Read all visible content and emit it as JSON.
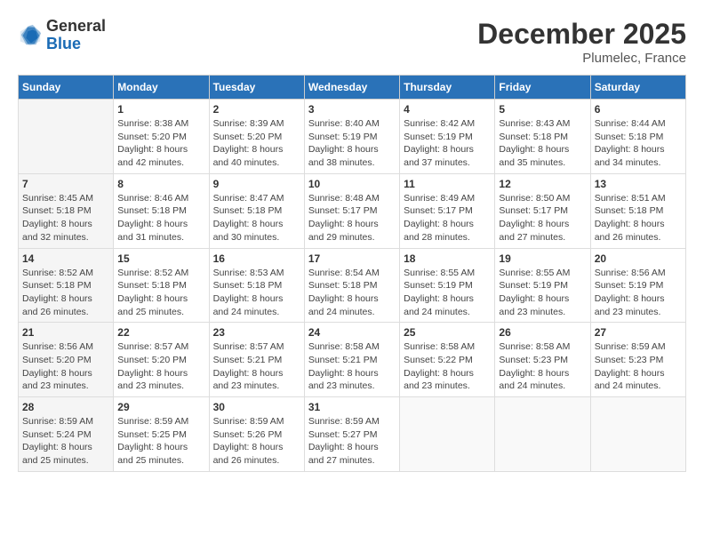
{
  "header": {
    "logo_general": "General",
    "logo_blue": "Blue",
    "month_title": "December 2025",
    "location": "Plumelec, France"
  },
  "days_of_week": [
    "Sunday",
    "Monday",
    "Tuesday",
    "Wednesday",
    "Thursday",
    "Friday",
    "Saturday"
  ],
  "weeks": [
    [
      {
        "day": "",
        "info": ""
      },
      {
        "day": "1",
        "info": "Sunrise: 8:38 AM\nSunset: 5:20 PM\nDaylight: 8 hours\nand 42 minutes."
      },
      {
        "day": "2",
        "info": "Sunrise: 8:39 AM\nSunset: 5:20 PM\nDaylight: 8 hours\nand 40 minutes."
      },
      {
        "day": "3",
        "info": "Sunrise: 8:40 AM\nSunset: 5:19 PM\nDaylight: 8 hours\nand 38 minutes."
      },
      {
        "day": "4",
        "info": "Sunrise: 8:42 AM\nSunset: 5:19 PM\nDaylight: 8 hours\nand 37 minutes."
      },
      {
        "day": "5",
        "info": "Sunrise: 8:43 AM\nSunset: 5:18 PM\nDaylight: 8 hours\nand 35 minutes."
      },
      {
        "day": "6",
        "info": "Sunrise: 8:44 AM\nSunset: 5:18 PM\nDaylight: 8 hours\nand 34 minutes."
      }
    ],
    [
      {
        "day": "7",
        "info": "Sunrise: 8:45 AM\nSunset: 5:18 PM\nDaylight: 8 hours\nand 32 minutes."
      },
      {
        "day": "8",
        "info": "Sunrise: 8:46 AM\nSunset: 5:18 PM\nDaylight: 8 hours\nand 31 minutes."
      },
      {
        "day": "9",
        "info": "Sunrise: 8:47 AM\nSunset: 5:18 PM\nDaylight: 8 hours\nand 30 minutes."
      },
      {
        "day": "10",
        "info": "Sunrise: 8:48 AM\nSunset: 5:17 PM\nDaylight: 8 hours\nand 29 minutes."
      },
      {
        "day": "11",
        "info": "Sunrise: 8:49 AM\nSunset: 5:17 PM\nDaylight: 8 hours\nand 28 minutes."
      },
      {
        "day": "12",
        "info": "Sunrise: 8:50 AM\nSunset: 5:17 PM\nDaylight: 8 hours\nand 27 minutes."
      },
      {
        "day": "13",
        "info": "Sunrise: 8:51 AM\nSunset: 5:18 PM\nDaylight: 8 hours\nand 26 minutes."
      }
    ],
    [
      {
        "day": "14",
        "info": "Sunrise: 8:52 AM\nSunset: 5:18 PM\nDaylight: 8 hours\nand 26 minutes."
      },
      {
        "day": "15",
        "info": "Sunrise: 8:52 AM\nSunset: 5:18 PM\nDaylight: 8 hours\nand 25 minutes."
      },
      {
        "day": "16",
        "info": "Sunrise: 8:53 AM\nSunset: 5:18 PM\nDaylight: 8 hours\nand 24 minutes."
      },
      {
        "day": "17",
        "info": "Sunrise: 8:54 AM\nSunset: 5:18 PM\nDaylight: 8 hours\nand 24 minutes."
      },
      {
        "day": "18",
        "info": "Sunrise: 8:55 AM\nSunset: 5:19 PM\nDaylight: 8 hours\nand 24 minutes."
      },
      {
        "day": "19",
        "info": "Sunrise: 8:55 AM\nSunset: 5:19 PM\nDaylight: 8 hours\nand 23 minutes."
      },
      {
        "day": "20",
        "info": "Sunrise: 8:56 AM\nSunset: 5:19 PM\nDaylight: 8 hours\nand 23 minutes."
      }
    ],
    [
      {
        "day": "21",
        "info": "Sunrise: 8:56 AM\nSunset: 5:20 PM\nDaylight: 8 hours\nand 23 minutes."
      },
      {
        "day": "22",
        "info": "Sunrise: 8:57 AM\nSunset: 5:20 PM\nDaylight: 8 hours\nand 23 minutes."
      },
      {
        "day": "23",
        "info": "Sunrise: 8:57 AM\nSunset: 5:21 PM\nDaylight: 8 hours\nand 23 minutes."
      },
      {
        "day": "24",
        "info": "Sunrise: 8:58 AM\nSunset: 5:21 PM\nDaylight: 8 hours\nand 23 minutes."
      },
      {
        "day": "25",
        "info": "Sunrise: 8:58 AM\nSunset: 5:22 PM\nDaylight: 8 hours\nand 23 minutes."
      },
      {
        "day": "26",
        "info": "Sunrise: 8:58 AM\nSunset: 5:23 PM\nDaylight: 8 hours\nand 24 minutes."
      },
      {
        "day": "27",
        "info": "Sunrise: 8:59 AM\nSunset: 5:23 PM\nDaylight: 8 hours\nand 24 minutes."
      }
    ],
    [
      {
        "day": "28",
        "info": "Sunrise: 8:59 AM\nSunset: 5:24 PM\nDaylight: 8 hours\nand 25 minutes."
      },
      {
        "day": "29",
        "info": "Sunrise: 8:59 AM\nSunset: 5:25 PM\nDaylight: 8 hours\nand 25 minutes."
      },
      {
        "day": "30",
        "info": "Sunrise: 8:59 AM\nSunset: 5:26 PM\nDaylight: 8 hours\nand 26 minutes."
      },
      {
        "day": "31",
        "info": "Sunrise: 8:59 AM\nSunset: 5:27 PM\nDaylight: 8 hours\nand 27 minutes."
      },
      {
        "day": "",
        "info": ""
      },
      {
        "day": "",
        "info": ""
      },
      {
        "day": "",
        "info": ""
      }
    ]
  ]
}
